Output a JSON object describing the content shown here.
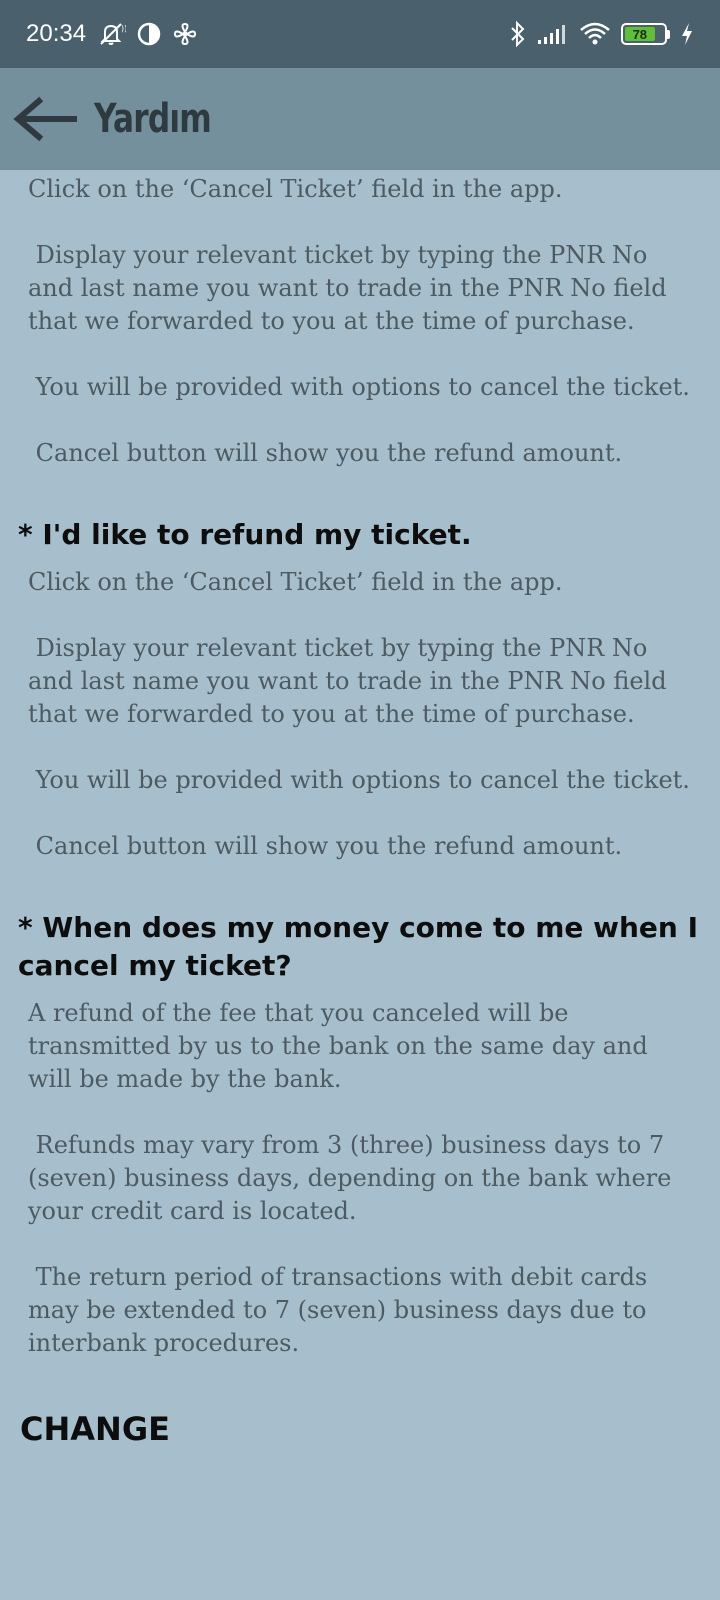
{
  "status_bar": {
    "time": "20:34",
    "battery_level": 78,
    "battery_text": "78",
    "icons": [
      "mute-icon",
      "app-icon",
      "fan-icon",
      "bluetooth-icon",
      "signal-icon",
      "wifi-icon",
      "battery-icon",
      "charging-icon"
    ]
  },
  "app_bar": {
    "title": "Yardım"
  },
  "sections": [
    {
      "paragraphs": [
        "Click on the ‘Cancel Ticket’ field in the app.",
        " Display your relevant ticket by typing the PNR No and last name you want to trade in the PNR No field that we forwarded to you at the time of purchase.",
        " You will be provided with options to cancel the ticket.",
        " Cancel button will show you the refund amount."
      ]
    },
    {
      "question": "* I'd like to refund my ticket.",
      "paragraphs": [
        "Click on the ‘Cancel Ticket’ field in the app.",
        " Display your relevant ticket by typing the PNR No and last name you want to trade in the PNR No field that we forwarded to you at the time of purchase.",
        " You will be provided with options to cancel the ticket.",
        " Cancel button will show you the refund amount."
      ]
    },
    {
      "question": "* When does my money come to me when I cancel my ticket?",
      "paragraphs": [
        "A refund of the fee that you canceled will be transmitted by us to the bank on the same day and will be made by the bank.",
        " Refunds may vary from 3 (three) business days to 7 (seven) business days, depending on the bank where your credit card is located.",
        " The return period of transactions with debit cards may be extended to 7 (seven) business days due to interbank procedures."
      ]
    }
  ],
  "change_heading": "CHANGE",
  "colors": {
    "status_bar": "#4a606c",
    "app_bar": "#74909c",
    "background": "#a7bfcc",
    "body_text": "#4d5a61",
    "heading_text": "#0d0d0d",
    "battery_fill": "#5fbf3a"
  }
}
